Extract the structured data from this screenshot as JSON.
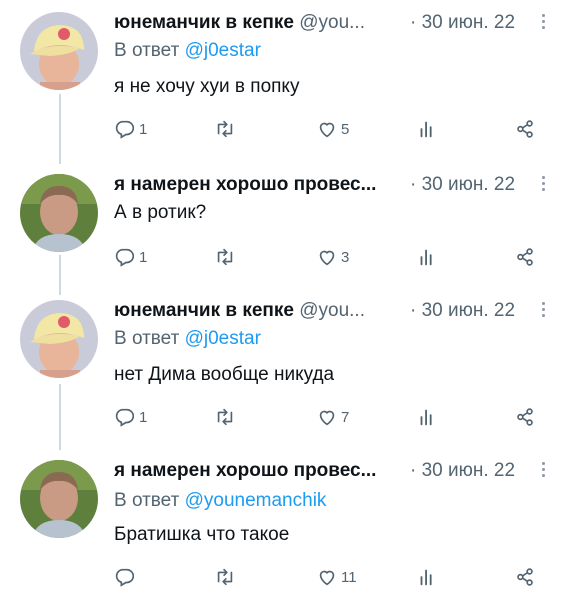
{
  "tweets": [
    {
      "name": "юнеманчик в кепке",
      "handle": "@you...",
      "date": "· 30 июн. 22",
      "reply_prefix": "В ответ",
      "reply_to": "@j0estar",
      "text": "я не хочу хуи в попку",
      "replies": "1",
      "retweets": "",
      "likes": "5",
      "avatar": "cap-avatar"
    },
    {
      "name": "я намерен хорошо провес...",
      "handle": "",
      "date": "· 30 июн. 22",
      "reply_prefix": "",
      "reply_to": "",
      "text": "А в ротик?",
      "replies": "1",
      "retweets": "",
      "likes": "3",
      "avatar": "green-avatar"
    },
    {
      "name": "юнеманчик в кепке",
      "handle": "@you...",
      "date": "· 30 июн. 22",
      "reply_prefix": "В ответ",
      "reply_to": "@j0estar",
      "text": "нет Дима вообще никуда",
      "replies": "1",
      "retweets": "",
      "likes": "7",
      "avatar": "cap-avatar"
    },
    {
      "name": "я намерен хорошо провес...",
      "handle": "",
      "date": "· 30 июн. 22",
      "reply_prefix": "В ответ",
      "reply_to": "@younemanchik",
      "text": "Братишка что такое",
      "replies": "",
      "retweets": "",
      "likes": "11",
      "avatar": "green-avatar"
    }
  ],
  "icons": {
    "reply": "reply-icon",
    "retweet": "retweet-icon",
    "like": "heart-icon",
    "views": "views-icon",
    "share": "share-icon",
    "more": "more-icon"
  }
}
